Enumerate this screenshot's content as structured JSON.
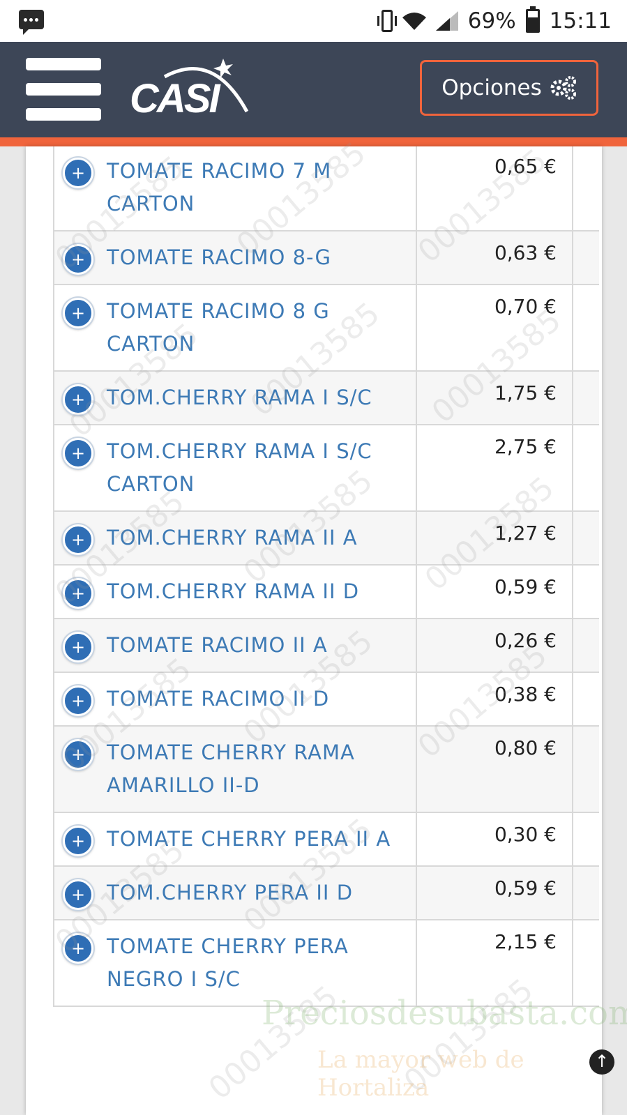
{
  "status_bar": {
    "battery": "69%",
    "time": "15:11"
  },
  "header": {
    "logo_text": "CASI",
    "options_label": "Opciones"
  },
  "products": [
    {
      "name": "TOMATE RACIMO 7 M CARTON",
      "price": "0,65 €"
    },
    {
      "name": "TOMATE RACIMO 8-G",
      "price": "0,63 €"
    },
    {
      "name": "TOMATE RACIMO 8 G CARTON",
      "price": "0,70 €"
    },
    {
      "name": "TOM.CHERRY RAMA I S/C",
      "price": "1,75 €"
    },
    {
      "name": "TOM.CHERRY RAMA I S/C CARTON",
      "price": "2,75 €"
    },
    {
      "name": "TOM.CHERRY RAMA II A",
      "price": "1,27 €"
    },
    {
      "name": "TOM.CHERRY RAMA II D",
      "price": "0,59 €"
    },
    {
      "name": "TOMATE RACIMO II A",
      "price": "0,26 €"
    },
    {
      "name": "TOMATE RACIMO II D",
      "price": "0,38 €"
    },
    {
      "name": "TOMATE CHERRY RAMA AMARILLO II-D",
      "price": "0,80 €"
    },
    {
      "name": "TOMATE CHERRY PERA II A",
      "price": "0,30 €"
    },
    {
      "name": "TOM.CHERRY PERA II D",
      "price": "0,59 €"
    },
    {
      "name": "TOMATE CHERRY PERA NEGRO I S/C",
      "price": "2,15 €"
    }
  ],
  "watermark": {
    "site": "Preciosdesubasta.com",
    "tagline": "La mayor web de Hortaliza"
  },
  "colors": {
    "header_bg": "#3d4657",
    "accent": "#f0643c",
    "link": "#3d7ab5",
    "plus_button": "#2f6eb5"
  }
}
